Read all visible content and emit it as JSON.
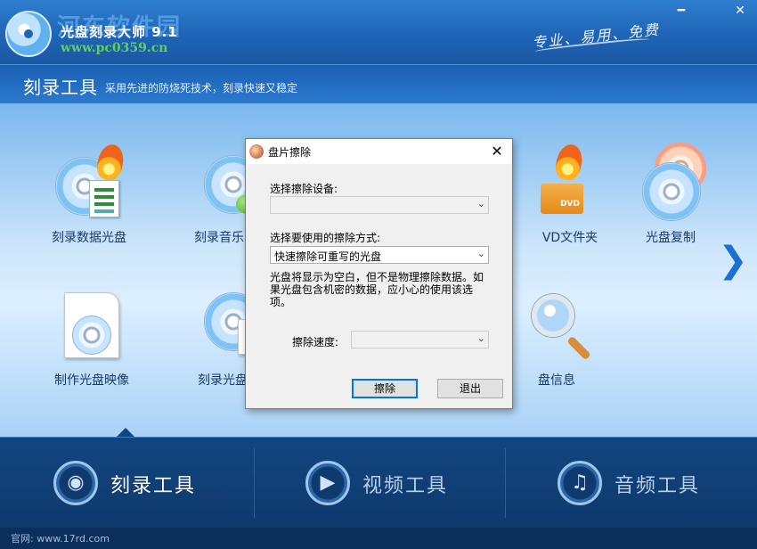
{
  "window": {
    "watermark": "河东软件园",
    "title": "光盘刻录大师 9.1",
    "site_mark": "www.pc0359.cn",
    "slogan": "专业、易用、免费",
    "minimize_glyph": "━",
    "close_glyph": "✕"
  },
  "header": {
    "title": "刻录工具",
    "subtitle": "采用先进的防烧死技术，刻录快速又稳定"
  },
  "tools": [
    {
      "label": "刻录数据光盘",
      "icon": "burn-data-disc-icon"
    },
    {
      "label": "刻录音乐",
      "icon": "burn-music-icon"
    },
    {
      "label": "VD文件夹",
      "icon": "dvd-folder-icon"
    },
    {
      "label": "光盘复制",
      "icon": "disc-copy-icon"
    },
    {
      "label": "制作光盘映像",
      "icon": "disc-image-icon"
    },
    {
      "label": "刻录光盘",
      "icon": "burn-disc-icon"
    },
    {
      "label": "盘信息",
      "icon": "disc-info-icon"
    }
  ],
  "next_glyph": "❯",
  "tabs": [
    {
      "label": "刻录工具",
      "icon": "disc-icon",
      "glyph": "◉",
      "active": true
    },
    {
      "label": "视频工具",
      "icon": "film-icon",
      "glyph": "▶"
    },
    {
      "label": "音频工具",
      "icon": "music-note-icon",
      "glyph": "♫"
    }
  ],
  "footer": {
    "link": "官网: www.17rd.com"
  },
  "dialog": {
    "title": "盘片擦除",
    "close_glyph": "✕",
    "device_label": "选择擦除设备:",
    "device_value": "",
    "method_label": "选择要使用的擦除方式:",
    "method_value": "快速擦除可重写的光盘",
    "note": "光盘将显示为空白，但不是物理擦除数据。如果光盘包含机密的数据，应小心的使用该选项。",
    "speed_label": "擦除速度:",
    "speed_value": "",
    "erase_button": "擦除",
    "exit_button": "退出",
    "chevron": "⌄"
  },
  "colors": {
    "titlebar": "#1f64b6",
    "tabs_bg": "#12457f",
    "dialog_default_border": "#0078d7"
  }
}
